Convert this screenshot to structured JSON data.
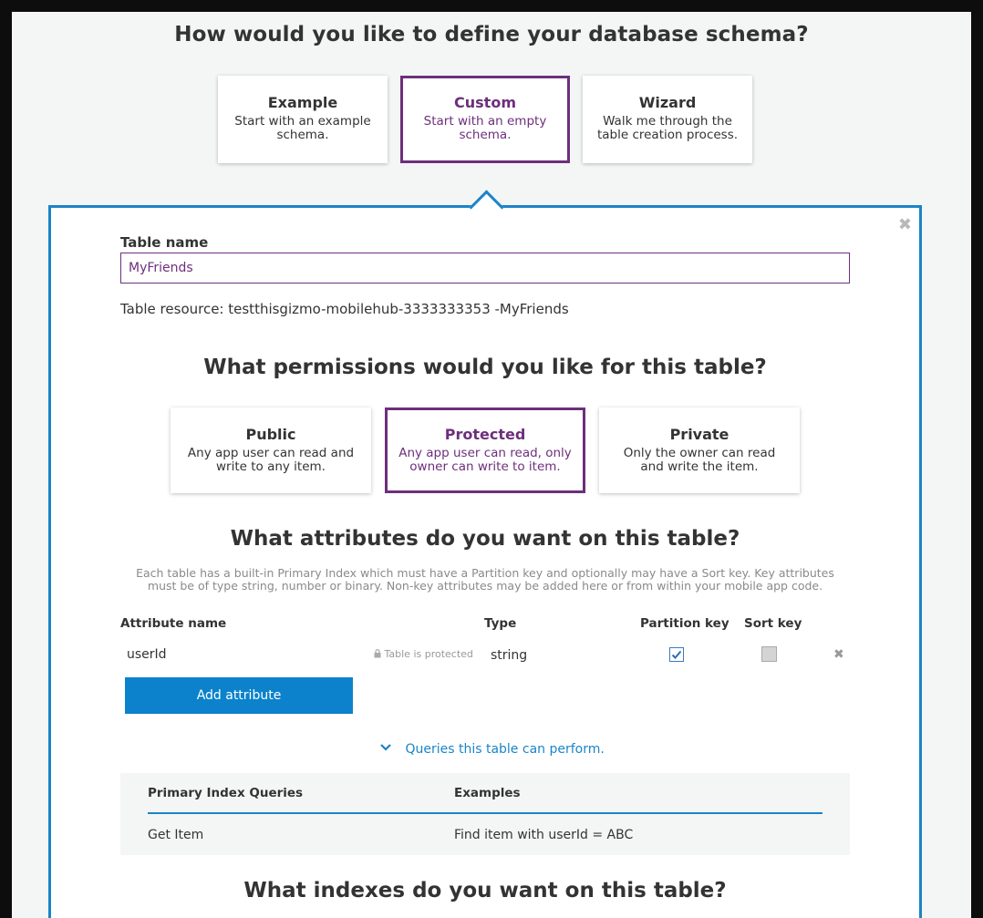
{
  "header": {
    "title": "How would you like to define your database schema?"
  },
  "schema_options": [
    {
      "title": "Example",
      "desc": "Start with an example schema.",
      "selected": false
    },
    {
      "title": "Custom",
      "desc": "Start with an empty schema.",
      "selected": true
    },
    {
      "title": "Wizard",
      "desc": "Walk me through the table creation process.",
      "selected": false
    }
  ],
  "panel": {
    "close_icon": "close-icon",
    "table_name_label": "Table name",
    "table_name_value": "MyFriends",
    "table_resource": "Table resource: testthisgizmo-mobilehub-3333333353 -MyFriends",
    "permissions_title": "What permissions would you like for this table?",
    "permissions": [
      {
        "title": "Public",
        "desc": "Any app user can read and write to any item.",
        "selected": false
      },
      {
        "title": "Protected",
        "desc": "Any app user can read, only owner can write to item.",
        "selected": true
      },
      {
        "title": "Private",
        "desc": "Only the owner can read and write the item.",
        "selected": false
      }
    ],
    "attributes_title": "What attributes do you want on this table?",
    "attributes_note": "Each table has a built-in Primary Index which must have a Partition key and optionally may have a Sort key. Key attributes must be of type string, number or binary. Non-key attributes may be added here or from within your mobile app code.",
    "columns": {
      "name": "Attribute name",
      "type": "Type",
      "partition": "Partition key",
      "sort": "Sort key"
    },
    "attributes": [
      {
        "name": "userId",
        "lock_text": "Table is protected",
        "type": "string",
        "partition_key": true,
        "sort_key": false
      }
    ],
    "add_attribute_label": "Add attribute",
    "queries_link": "Queries this table can perform.",
    "queries_table": {
      "headers": [
        "Primary Index Queries",
        "Examples"
      ],
      "rows": [
        [
          "Get Item",
          "Find item with userId = ABC"
        ]
      ]
    },
    "indexes_title": "What indexes do you want on this table?"
  },
  "colors": {
    "accent_purple": "#6d2f7c",
    "accent_blue": "#1b84c7",
    "button_blue": "#0b82cb"
  }
}
